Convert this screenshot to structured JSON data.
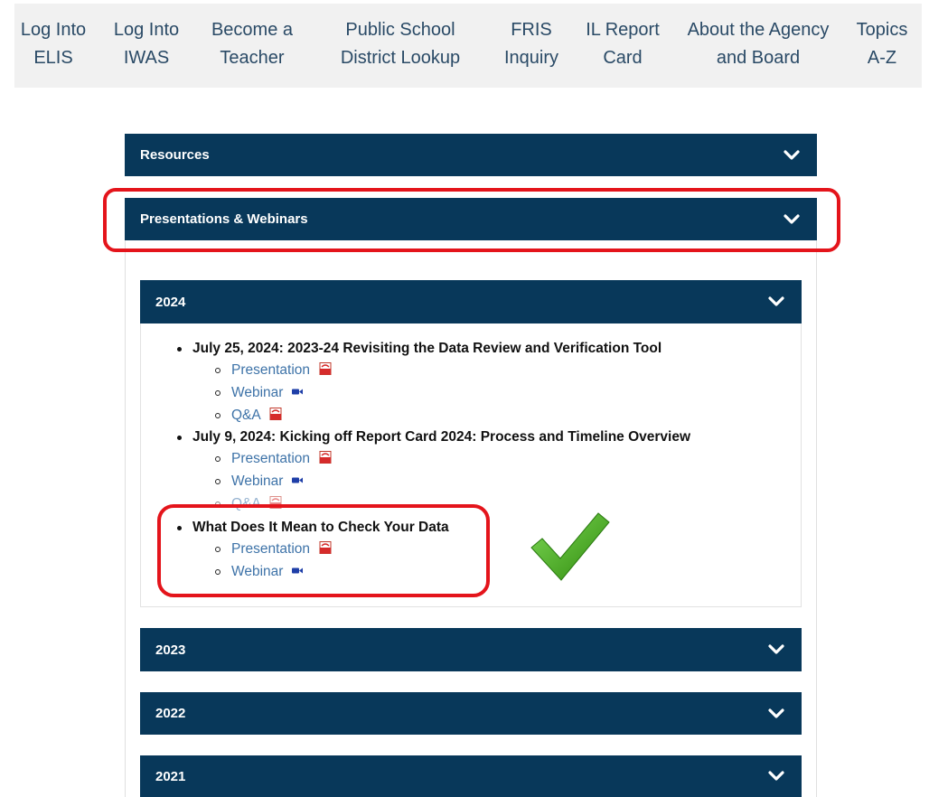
{
  "nav": {
    "items": [
      {
        "label": "Log Into\nELIS"
      },
      {
        "label": "Log Into\nIWAS"
      },
      {
        "label": "Become a\nTeacher"
      },
      {
        "label": "Public School\nDistrict Lookup"
      },
      {
        "label": "FRIS\nInquiry"
      },
      {
        "label": "IL Report\nCard"
      },
      {
        "label": "About the Agency\nand Board"
      },
      {
        "label": "Topics\nA-Z"
      }
    ]
  },
  "accordion": {
    "resources_label": "Resources",
    "presentations_label": "Presentations & Webinars",
    "years": {
      "y2024": "2024",
      "y2023": "2023",
      "y2022": "2022",
      "y2021": "2021"
    }
  },
  "entries": [
    {
      "title": "July 25, 2024: 2023-24 Revisiting the Data Review and Verification Tool",
      "links": {
        "presentation": "Presentation",
        "webinar": "Webinar",
        "qa": "Q&A"
      }
    },
    {
      "title": "July 9, 2024: Kicking off Report Card 2024: Process and Timeline Overview",
      "links": {
        "presentation": "Presentation",
        "webinar": "Webinar",
        "qa": "Q&A"
      }
    },
    {
      "title": "What Does It Mean to Check Your Data",
      "links": {
        "presentation": "Presentation",
        "webinar": "Webinar"
      }
    }
  ],
  "colors": {
    "accordion_header": "#08385a",
    "nav_background": "#f1f1f1",
    "nav_text": "#2a4a66",
    "link": "#3e73a8",
    "highlight": "#e4141b",
    "checkmark": "#3fa012"
  },
  "icons": {
    "chevron": "chevron-down-icon",
    "pdf": "pdf-icon",
    "video": "video-camera-icon",
    "annotation": "checkmark-icon"
  }
}
